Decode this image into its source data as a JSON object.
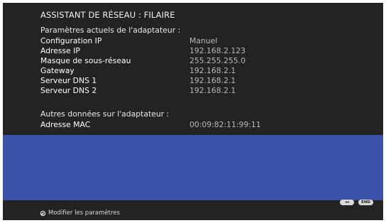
{
  "title": "ASSISTANT DE RÉSEAU : FILAIRE",
  "current_section": {
    "heading": "Paramètres actuels de l'adaptateur :",
    "rows": [
      {
        "label": "Configuration IP",
        "value": "Manuel"
      },
      {
        "label": "Adresse IP",
        "value": "192.168.2.123"
      },
      {
        "label": "Masque de sous-réseau",
        "value": "255.255.255.0"
      },
      {
        "label": "Gateway",
        "value": "192.168.2.1"
      },
      {
        "label": "Serveur DNS 1",
        "value": "192.168.2.1"
      },
      {
        "label": "Serveur DNS 2",
        "value": "192.168.2.1"
      }
    ]
  },
  "other_section": {
    "heading": "Autres données sur l'adaptateur :",
    "rows": [
      {
        "label": "Adresse MAC",
        "value": "00:09:82:11:99:11"
      }
    ]
  },
  "buttons": {
    "back_label": "◂◂",
    "end_label": "END"
  },
  "footer": {
    "icon": "refresh-icon",
    "label": "Modifier les paramètres"
  },
  "colors": {
    "background": "#232323",
    "panel": "#3a53a9",
    "value_text": "#b8b8b8"
  }
}
